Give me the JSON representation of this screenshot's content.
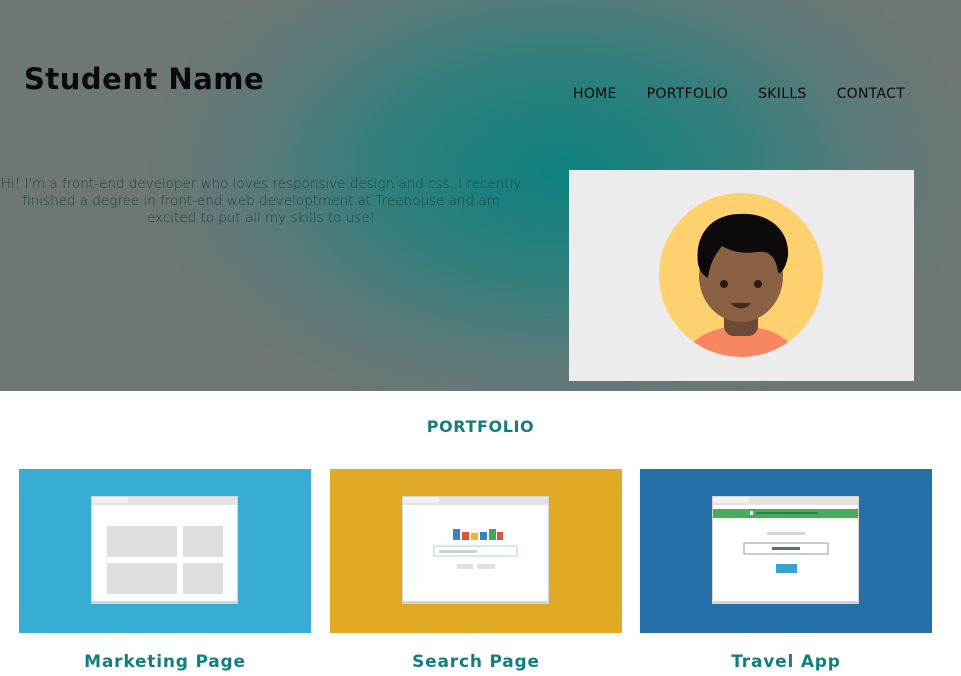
{
  "header": {
    "title": "Student Name",
    "nav": [
      "HOME",
      "PORTFOLIO",
      "SKILLS",
      "CONTACT"
    ]
  },
  "intro": {
    "text": "Hi! I'm a front-end developer who loves responsive design and css. I recently finished a degree in front-end web developtment at Treehouse and am excited to put all my skills to use!"
  },
  "avatar": {
    "icon": "person-avatar-icon"
  },
  "portfolio": {
    "heading": "PORTFOLIO",
    "items": [
      {
        "title": "Marketing Page",
        "color": "#37acd4",
        "icon": "marketing-page-icon"
      },
      {
        "title": "Search Page",
        "color": "#e0aa27",
        "icon": "search-page-icon"
      },
      {
        "title": "Travel App",
        "color": "#2570a9",
        "icon": "travel-app-icon"
      }
    ]
  },
  "colors": {
    "accent": "#127e80",
    "hero": "#0d8180"
  }
}
